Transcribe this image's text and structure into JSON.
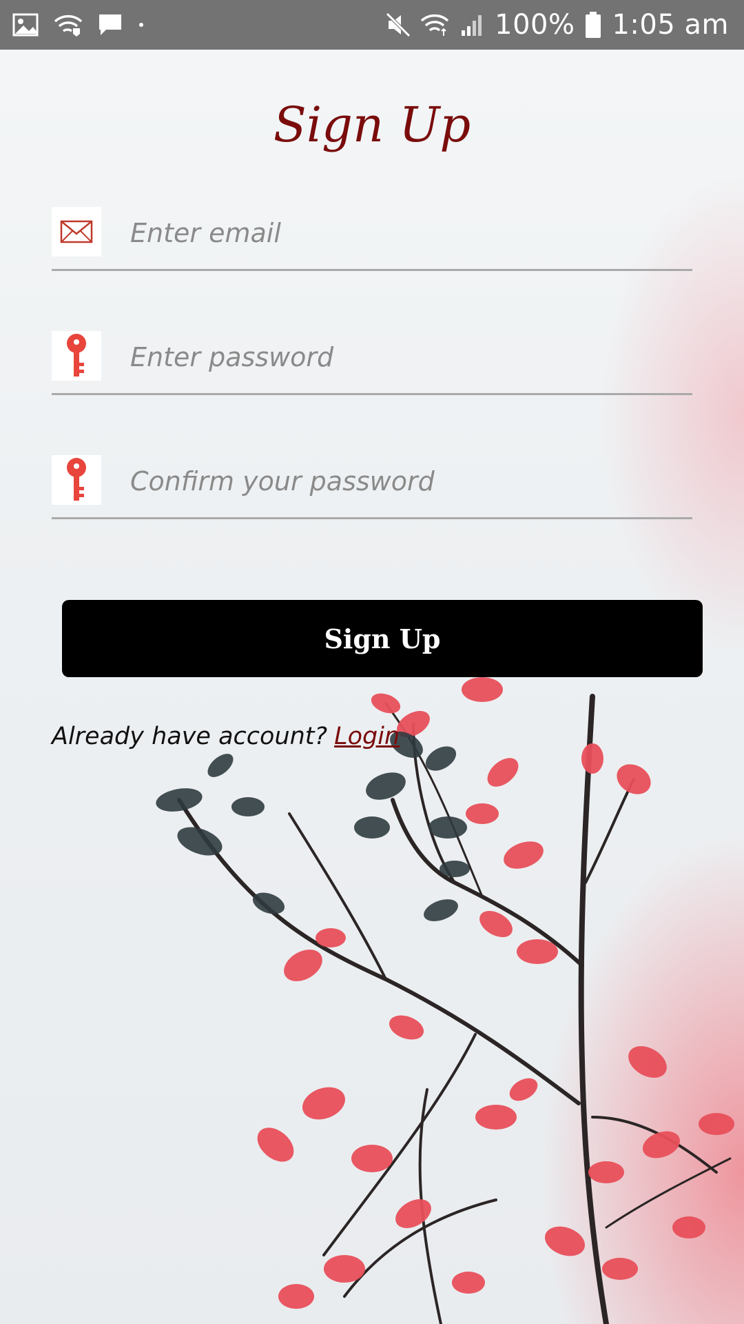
{
  "status_bar": {
    "battery": "100%",
    "time": "1:05 am"
  },
  "title": "Sign Up",
  "fields": [
    {
      "placeholder": "Enter email",
      "value": "",
      "icon": "email-icon"
    },
    {
      "placeholder": "Enter password",
      "value": "",
      "icon": "key-icon"
    },
    {
      "placeholder": "Confirm your password",
      "value": "",
      "icon": "key-icon"
    }
  ],
  "signup_button": "Sign Up",
  "login_prompt": {
    "text": "Already have account?",
    "link": "Login"
  },
  "colors": {
    "title": "#7a0c0c",
    "button": "#000000",
    "icon_red": "#e8453c",
    "status_bar": "#737373"
  }
}
